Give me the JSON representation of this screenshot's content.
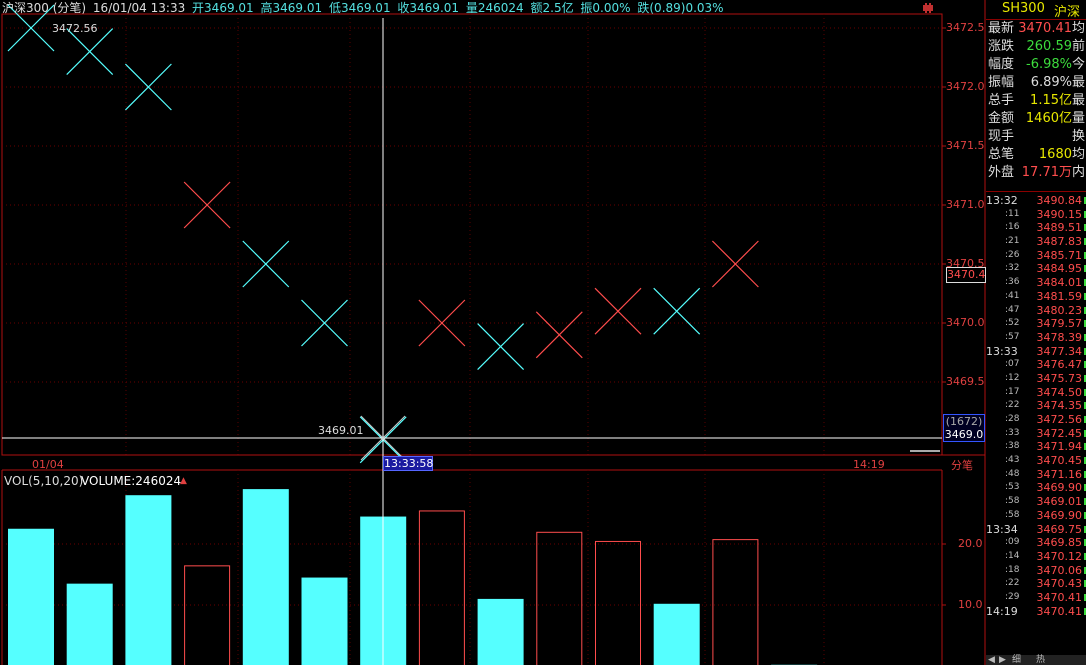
{
  "header": {
    "title": "沪深300 (分笔)",
    "date_time": "16/01/04 13:33",
    "open": "开3469.01",
    "high": "高3469.01",
    "low": "低3469.01",
    "close": "收3469.01",
    "volume": "量246024",
    "amount": "额2.5亿",
    "amplitude": "振0.00%",
    "change": "跌(0.89)0.03%"
  },
  "y_axis": {
    "labels": [
      "3472.5",
      "3472.0",
      "3471.5",
      "3471.0",
      "3470.5",
      "3470.0",
      "3469.5"
    ],
    "current_marker": "3470.4",
    "crosshair_count": "(1672)",
    "crosshair_price": "3469.0"
  },
  "x_axis": {
    "date": "01/04",
    "crosshair_time": "13:33:58",
    "end_time": "14:19",
    "mode_label": "分笔"
  },
  "annotations": {
    "max_label": "3472.56",
    "crosshair_value": "3469.01"
  },
  "volume_panel": {
    "title": "VOL(5,10,20)",
    "volume_label": "VOLUME:246024",
    "y_labels": [
      "20.0",
      "10.0"
    ]
  },
  "colors": {
    "up": "#ff4d4d",
    "down": "#55ffff",
    "grid": "#8b0000",
    "background": "#000000"
  },
  "chart_data": {
    "type": "candlestick",
    "price_ylim": [
      3469.01,
      3472.56
    ],
    "ticks": [
      {
        "price": 3472.5,
        "dir": "down",
        "volume": 22.5
      },
      {
        "price": 3472.3,
        "dir": "down",
        "volume": 13.5
      },
      {
        "price": 3472.0,
        "dir": "down",
        "volume": 28.0
      },
      {
        "price": 3471.0,
        "dir": "up",
        "volume": 16.5
      },
      {
        "price": 3470.5,
        "dir": "down",
        "volume": 29.0
      },
      {
        "price": 3470.0,
        "dir": "down",
        "volume": 14.5
      },
      {
        "price": 3469.01,
        "dir": "down",
        "volume": 24.5
      },
      {
        "price": 3470.0,
        "dir": "up",
        "volume": 25.5
      },
      {
        "price": 3469.8,
        "dir": "down",
        "volume": 11.0
      },
      {
        "price": 3469.9,
        "dir": "up",
        "volume": 22.0
      },
      {
        "price": 3470.1,
        "dir": "up",
        "volume": 20.5
      },
      {
        "price": 3470.1,
        "dir": "down",
        "volume": 10.2
      },
      {
        "price": 3470.5,
        "dir": "up",
        "volume": 20.8
      },
      {
        "price": 3470.5,
        "dir": "down",
        "volume": 0.2
      },
      {
        "price": 3470.5,
        "dir": "down",
        "volume": 0.0
      }
    ]
  },
  "quote_panel": {
    "symbol": "SH300",
    "name": "沪深",
    "rows": [
      {
        "label": "最新",
        "value": "3470.41",
        "color": "#ff4d4d",
        "tail": "均"
      },
      {
        "label": "涨跌",
        "value": "260.59",
        "color": "#3ddc3d",
        "tail": "前"
      },
      {
        "label": "幅度",
        "value": "-6.98%",
        "color": "#3ddc3d",
        "tail": "今"
      },
      {
        "label": "振幅",
        "value": "6.89%",
        "color": "#dddddd",
        "tail": "最"
      },
      {
        "label": "总手",
        "value": "1.15亿",
        "color": "#e8e800",
        "tail": "最"
      },
      {
        "label": "金额",
        "value": "1460亿",
        "color": "#e8e800",
        "tail": "量"
      },
      {
        "label": "现手",
        "value": "",
        "color": "#e8e800",
        "tail": "换"
      },
      {
        "label": "总笔",
        "value": "1680",
        "color": "#e8e800",
        "tail": "均"
      },
      {
        "label": "外盘",
        "value": "17.71万",
        "color": "#ff4d4d",
        "tail": "内"
      }
    ]
  },
  "tick_list": [
    {
      "time": "13:32",
      "small": false,
      "price": "3490.84"
    },
    {
      "time": ":11",
      "small": true,
      "price": "3490.15"
    },
    {
      "time": ":16",
      "small": true,
      "price": "3489.51"
    },
    {
      "time": ":21",
      "small": true,
      "price": "3487.83"
    },
    {
      "time": ":26",
      "small": true,
      "price": "3485.71"
    },
    {
      "time": ":32",
      "small": true,
      "price": "3484.95"
    },
    {
      "time": ":36",
      "small": true,
      "price": "3484.01"
    },
    {
      "time": ":41",
      "small": true,
      "price": "3481.59"
    },
    {
      "time": ":47",
      "small": true,
      "price": "3480.23"
    },
    {
      "time": ":52",
      "small": true,
      "price": "3479.57"
    },
    {
      "time": ":57",
      "small": true,
      "price": "3478.39"
    },
    {
      "time": "13:33",
      "small": false,
      "price": "3477.34"
    },
    {
      "time": ":07",
      "small": true,
      "price": "3476.47"
    },
    {
      "time": ":12",
      "small": true,
      "price": "3475.73"
    },
    {
      "time": ":17",
      "small": true,
      "price": "3474.50"
    },
    {
      "time": ":22",
      "small": true,
      "price": "3474.35"
    },
    {
      "time": ":28",
      "small": true,
      "price": "3472.56"
    },
    {
      "time": ":33",
      "small": true,
      "price": "3472.45"
    },
    {
      "time": ":38",
      "small": true,
      "price": "3471.94"
    },
    {
      "time": ":43",
      "small": true,
      "price": "3470.45"
    },
    {
      "time": ":48",
      "small": true,
      "price": "3471.16"
    },
    {
      "time": ":53",
      "small": true,
      "price": "3469.90"
    },
    {
      "time": ":58",
      "small": true,
      "price": "3469.01"
    },
    {
      "time": ":58",
      "small": true,
      "price": "3469.90"
    },
    {
      "time": "13:34",
      "small": false,
      "price": "3469.75"
    },
    {
      "time": ":09",
      "small": true,
      "price": "3469.85"
    },
    {
      "time": ":14",
      "small": true,
      "price": "3470.12"
    },
    {
      "time": ":18",
      "small": true,
      "price": "3470.06"
    },
    {
      "time": ":22",
      "small": true,
      "price": "3470.43"
    },
    {
      "time": ":29",
      "small": true,
      "price": "3470.41"
    },
    {
      "time": "14:19",
      "small": false,
      "price": "3470.41"
    }
  ],
  "bottom_tabs": [
    "细",
    "热"
  ]
}
